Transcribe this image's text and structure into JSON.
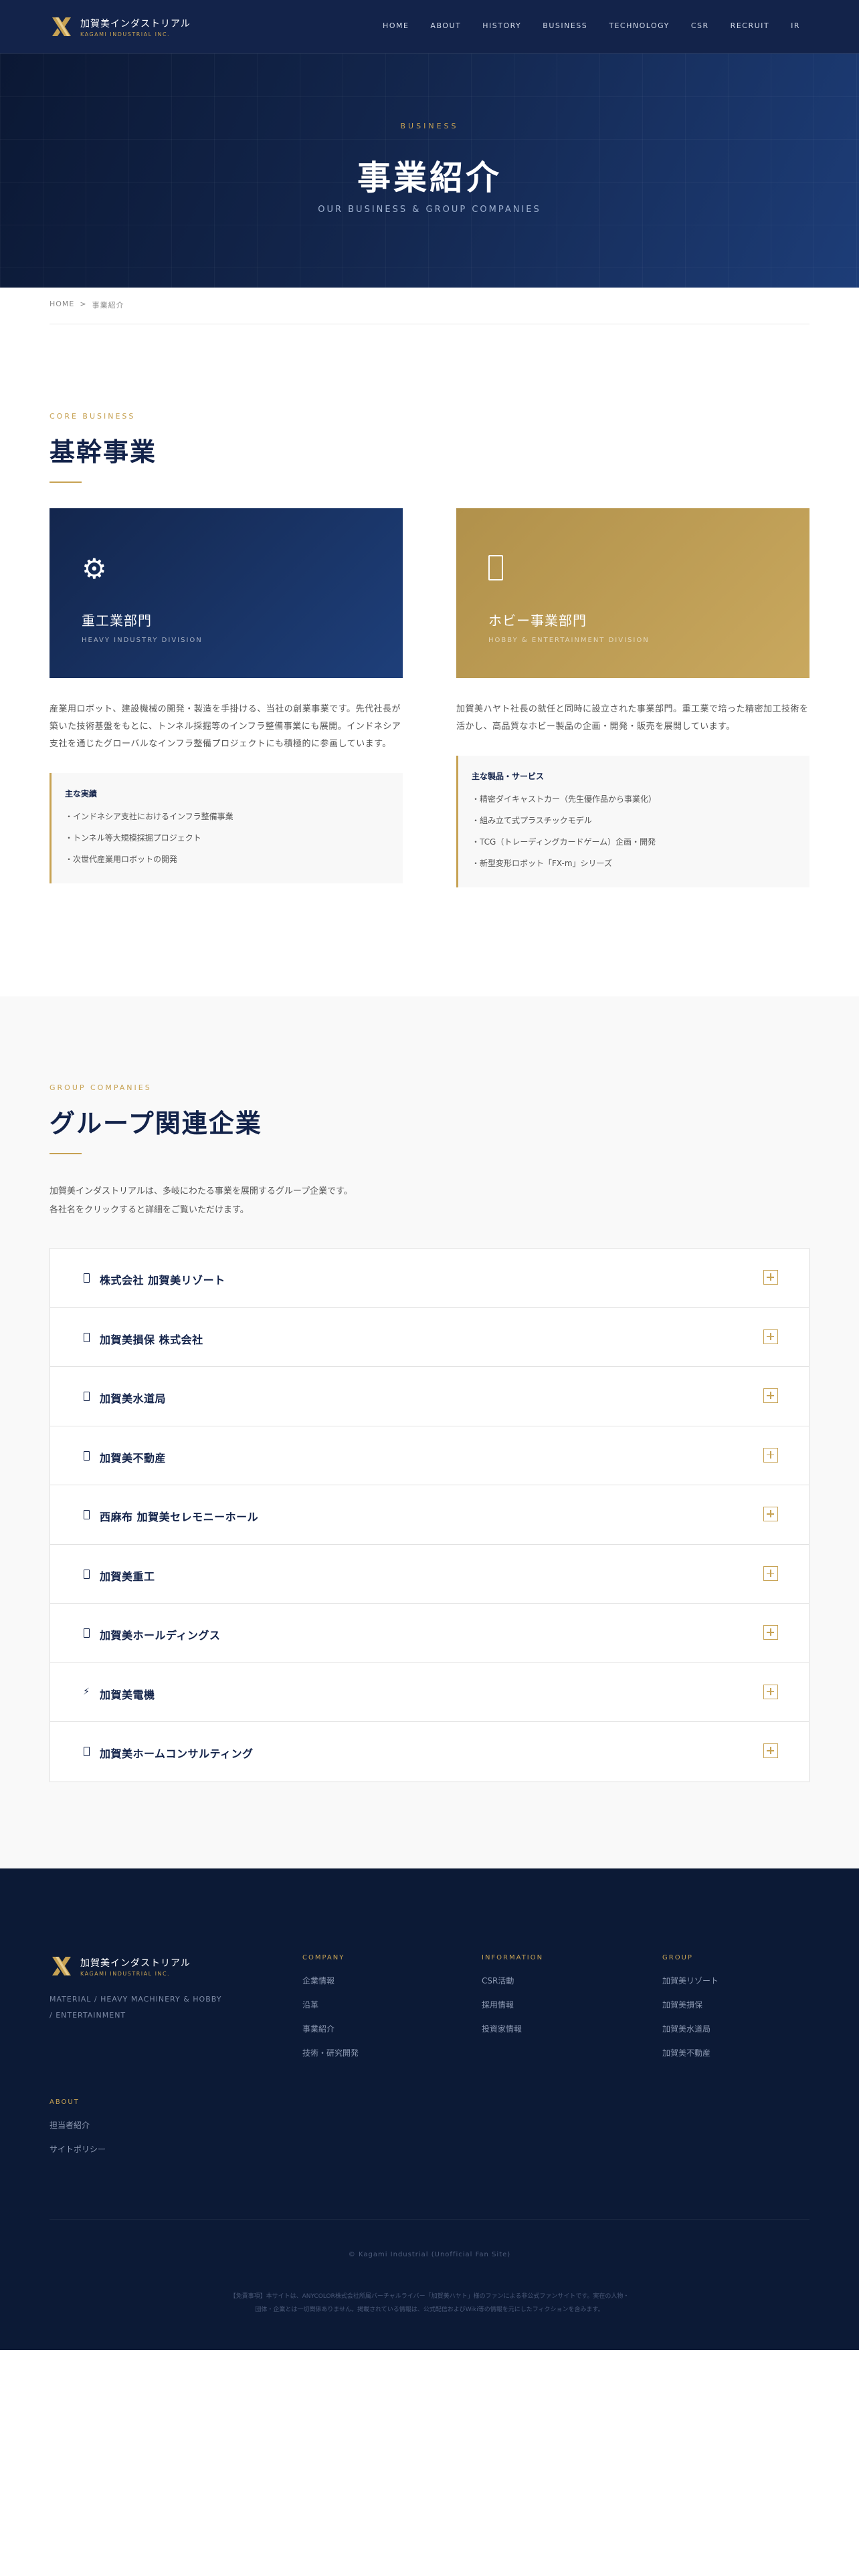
{
  "header": {
    "logo_jp": "加賀美インダストリアル",
    "logo_en": "KAGAMI INDUSTRIAL INC.",
    "nav": [
      "HOME",
      "ABOUT",
      "HISTORY",
      "BUSINESS",
      "TECHNOLOGY",
      "CSR",
      "RECRUIT",
      "IR"
    ]
  },
  "hero": {
    "eyebrow": "BUSINESS",
    "title": "事業紹介",
    "subtitle": "OUR BUSINESS & GROUP COMPANIES"
  },
  "breadcrumb": {
    "home": "HOME",
    "separator": ">",
    "current": "事業紹介"
  },
  "core": {
    "eyebrow": "CORE BUSINESS",
    "title": "基幹事業",
    "divisions": [
      {
        "icon": "gear-icon",
        "name": "重工業部門",
        "name_en": "HEAVY INDUSTRY DIVISION",
        "desc": "産業用ロボット、建設機械の開発・製造を手掛ける、当社の創業事業です。先代社長が築いた技術基盤をもとに、トンネル採掘等のインフラ整備事業にも展開。インドネシア支社を通じたグローバルなインフラ整備プロジェクトにも積極的に参画しています。",
        "list_title": "主な実績",
        "items": [
          "インドネシア支社におけるインフラ整備事業",
          "トンネル等大規模採掘プロジェクト",
          "次世代産業用ロボットの開発"
        ]
      },
      {
        "icon": "box-icon",
        "name": "ホビー事業部門",
        "name_en": "HOBBY & ENTERTAINMENT DIVISION",
        "desc": "加賀美ハヤト社長の就任と同時に設立された事業部門。重工業で培った精密加工技術を活かし、高品質なホビー製品の企画・開発・販売を展開しています。",
        "list_title": "主な製品・サービス",
        "items": [
          "精密ダイキャストカー（先生優作品から事業化）",
          "組み立て式プラスチックモデル",
          "TCG（トレーディングカードゲーム）企画・開発",
          "新型変形ロボット「FX-m」シリーズ"
        ]
      }
    ]
  },
  "group": {
    "eyebrow": "GROUP COMPANIES",
    "title": "グループ関連企業",
    "intro": [
      "加賀美インダストリアルは、多岐にわたる事業を展開するグループ企業です。",
      "各社名をクリックすると詳細をご覧いただけます。"
    ],
    "companies": [
      {
        "name": "株式会社 加賀美リゾート",
        "icon": "building-icon"
      },
      {
        "name": "加賀美損保 株式会社",
        "icon": "building-icon"
      },
      {
        "name": "加賀美水道局",
        "icon": "building-icon"
      },
      {
        "name": "加賀美不動産",
        "icon": "building-icon"
      },
      {
        "name": "西麻布 加賀美セレモニーホール",
        "icon": "building-icon"
      },
      {
        "name": "加賀美重工",
        "icon": "building-icon"
      },
      {
        "name": "加賀美ホールディングス",
        "icon": "building-icon"
      },
      {
        "name": "加賀美電機",
        "icon": "lightning-icon",
        "glyph": "⚡"
      },
      {
        "name": "加賀美ホームコンサルティング",
        "icon": "building-icon"
      }
    ]
  },
  "footer": {
    "logo_jp": "加賀美インダストリアル",
    "logo_en": "KAGAMI INDUSTRIAL INC.",
    "tagline": "MATERIAL / HEAVY MACHINERY & HOBBY / ENTERTAINMENT",
    "columns": [
      {
        "title": "COMPANY",
        "links": [
          "企業情報",
          "沿革",
          "事業紹介",
          "技術・研究開発"
        ]
      },
      {
        "title": "INFORMATION",
        "links": [
          "CSR活動",
          "採用情報",
          "投資家情報"
        ]
      },
      {
        "title": "GROUP",
        "links": [
          "加賀美リゾート",
          "加賀美損保",
          "加賀美水道局",
          "加賀美不動産"
        ]
      },
      {
        "title": "ABOUT",
        "links": [
          "担当者紹介",
          "サイトポリシー"
        ]
      }
    ],
    "copyright": "© Kagami Industrial (Unofficial Fan Site)",
    "disclaimer": "【免責事項】本サイトは、ANYCOLOR株式会社所属バーチャルライバー「加賀美ハヤト」様のファンによる非公式ファンサイトです。実在の人物・団体・企業とは一切関係ありません。掲載されている情報は、公式配信およびWiki等の情報を元にしたフィクションを含みます。"
  },
  "colors": {
    "navy": "#13234a",
    "gold": "#c7a253",
    "light_bg": "#f9f9f9"
  }
}
